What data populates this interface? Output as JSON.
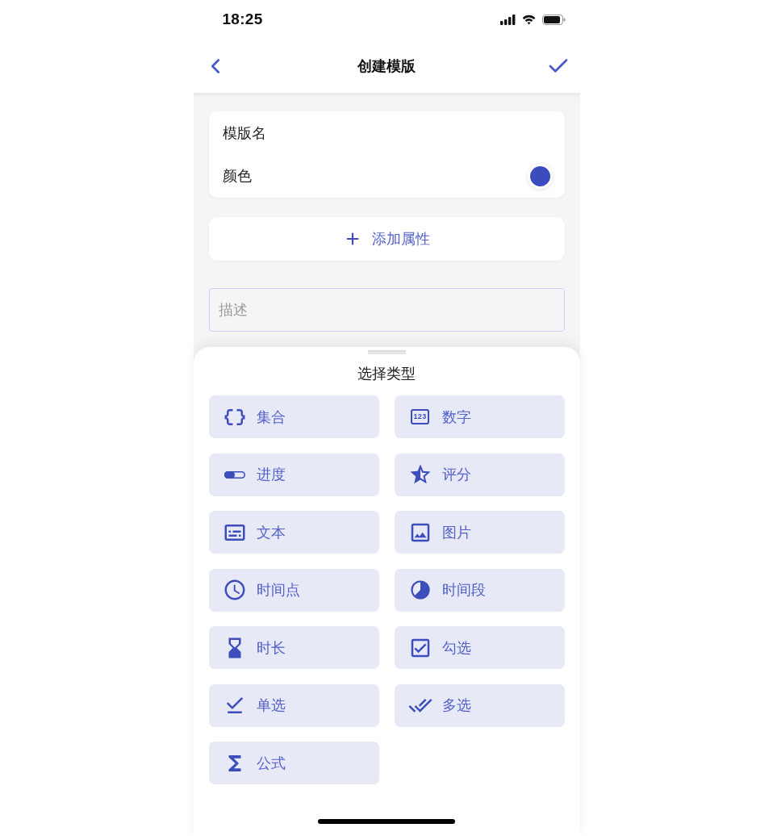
{
  "status_bar": {
    "time": "18:25"
  },
  "nav_bar": {
    "title": "创建模版"
  },
  "form": {
    "rows": [
      {
        "kind": "text",
        "label": "模版名"
      },
      {
        "kind": "color",
        "label": "颜色",
        "color": "#3b4dbd"
      }
    ]
  },
  "add_attribute_button": {
    "label": "添加属性"
  },
  "description_field": {
    "placeholder": "描述"
  },
  "type_sheet": {
    "title": "选择类型",
    "types": [
      {
        "kind": "collection",
        "label": "集合"
      },
      {
        "kind": "number",
        "label": "数字",
        "icon_text": "123"
      },
      {
        "kind": "progress",
        "label": "进度"
      },
      {
        "kind": "rating",
        "label": "评分"
      },
      {
        "kind": "text",
        "label": "文本"
      },
      {
        "kind": "image",
        "label": "图片"
      },
      {
        "kind": "timepoint",
        "label": "时间点"
      },
      {
        "kind": "timerange",
        "label": "时间段"
      },
      {
        "kind": "duration",
        "label": "时长"
      },
      {
        "kind": "checkbox",
        "label": "勾选"
      },
      {
        "kind": "single",
        "label": "单选"
      },
      {
        "kind": "multiple",
        "label": "多选"
      },
      {
        "kind": "formula",
        "label": "公式"
      }
    ]
  }
}
